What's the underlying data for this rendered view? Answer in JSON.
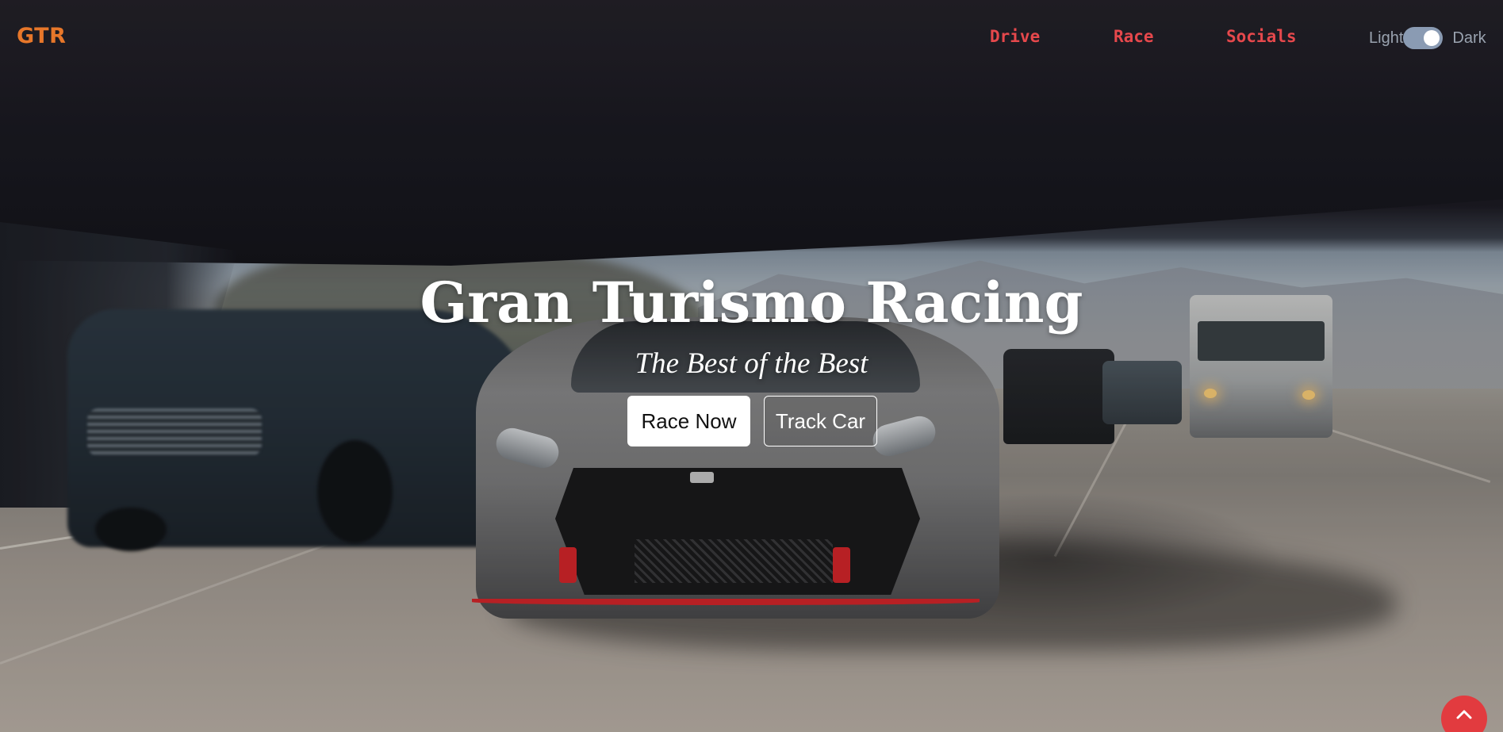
{
  "nav": {
    "logo": "GTR",
    "links": [
      {
        "label": "Drive"
      },
      {
        "label": "Race"
      },
      {
        "label": "Socials"
      }
    ],
    "theme": {
      "light_label": "Light",
      "dark_label": "Dark",
      "mode": "dark"
    }
  },
  "hero": {
    "title": "Gran Turismo Racing",
    "subtitle": "The Best of the Best",
    "primary_button": "Race Now",
    "secondary_button": "Track Car"
  },
  "scroll_top": {
    "icon": "chevron-up-icon"
  },
  "colors": {
    "logo": "#e7772a",
    "nav_link": "#e6484c",
    "scroll_top": "#e23b3f",
    "toggle_track": "#8a9bb3"
  }
}
